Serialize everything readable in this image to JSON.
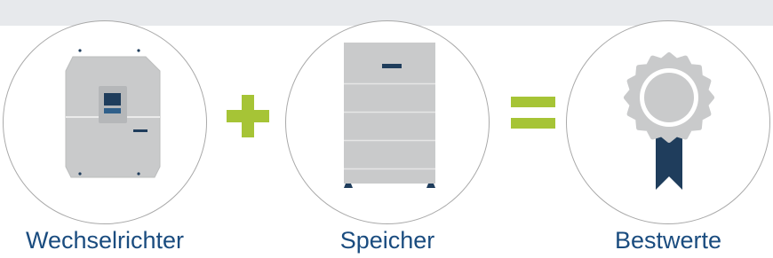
{
  "labels": {
    "inverter": "Wechselrichter",
    "storage": "Speicher",
    "result": "Bestwerte"
  },
  "icons": {
    "inverter": "inverter-icon",
    "storage": "battery-storage-icon",
    "result": "award-ribbon-icon",
    "plus": "plus-icon",
    "equals": "equals-icon"
  },
  "colors": {
    "label_text": "#1a4c7f",
    "accent_green": "#a6c436",
    "device_grey": "#c9cacb",
    "navy": "#1f3d5c",
    "top_band": "#e7e9ec",
    "circle_border": "#a9a9a9"
  }
}
